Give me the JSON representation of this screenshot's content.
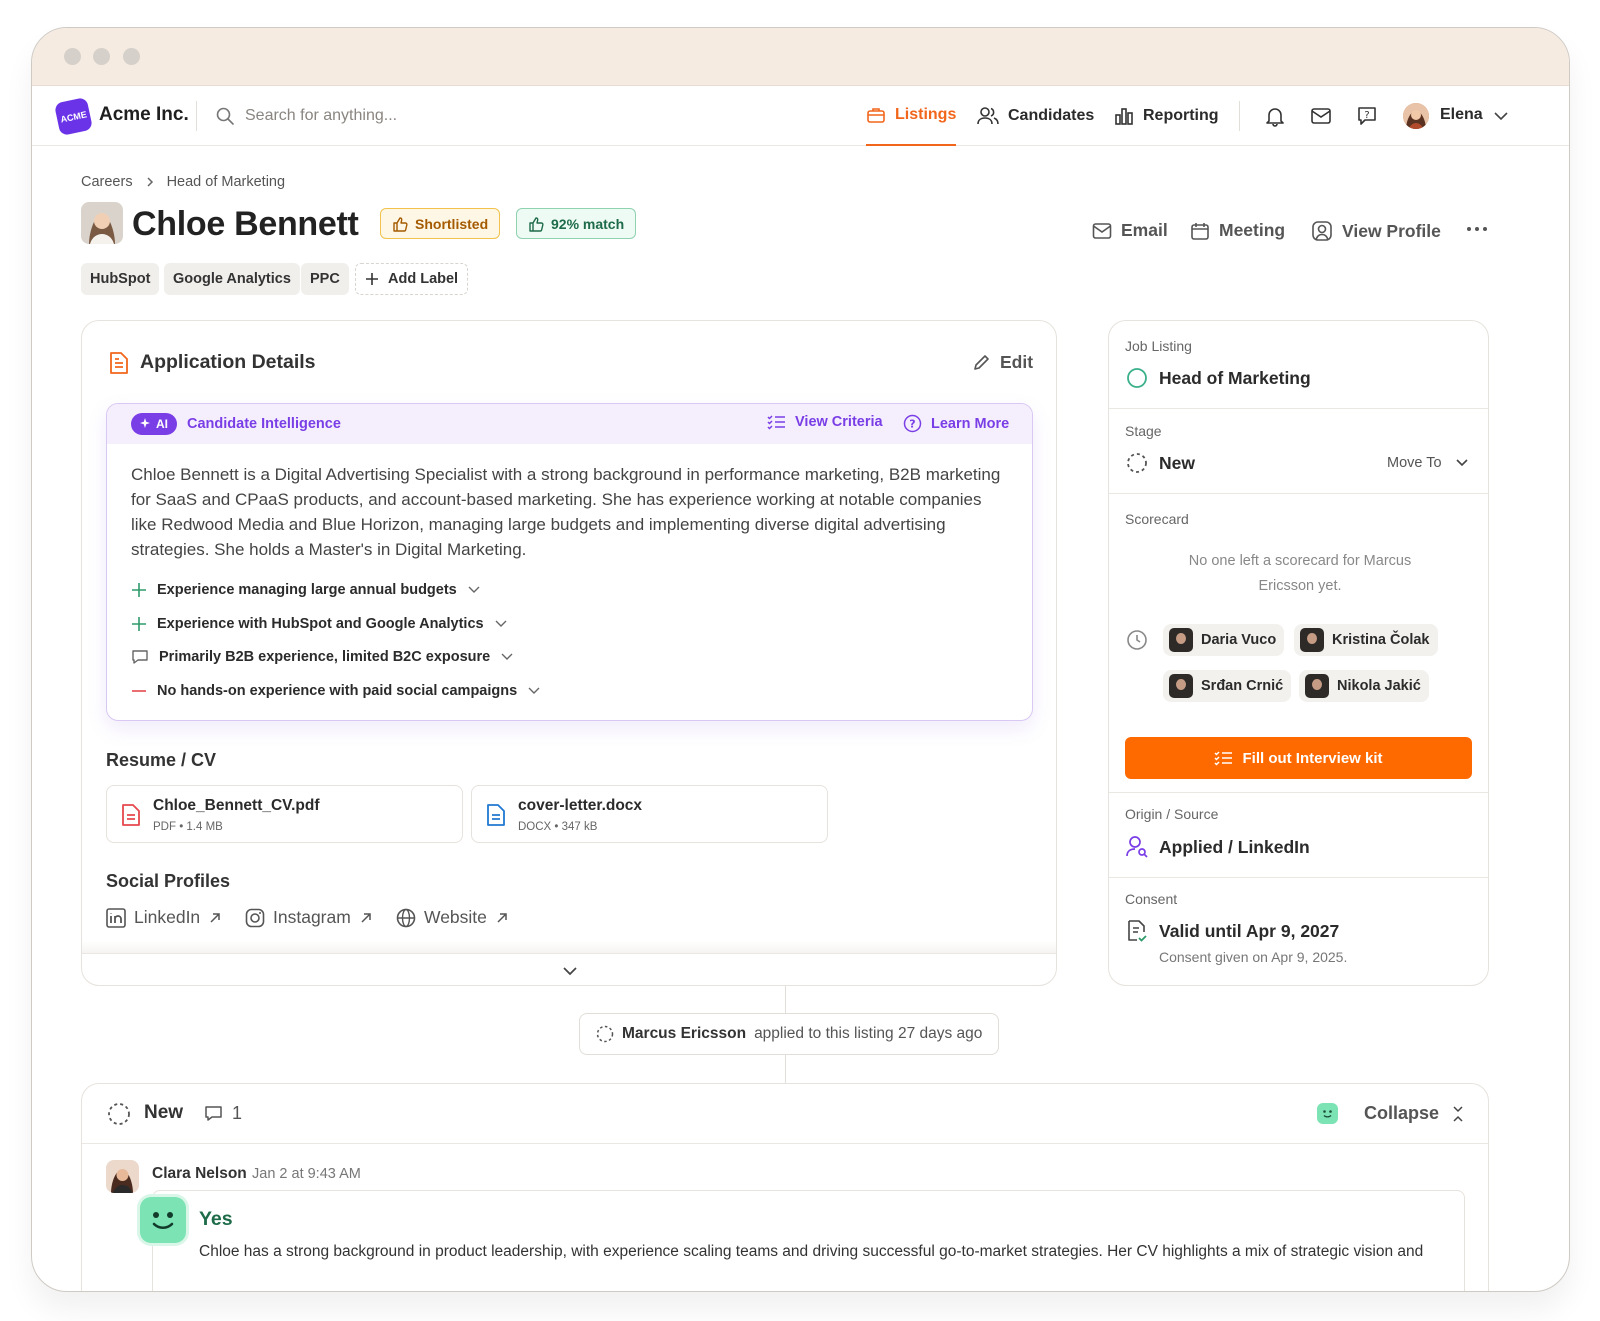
{
  "app": {
    "brand": "Acme Inc.",
    "logo_text": "ACME",
    "search_placeholder": "Search for anything...",
    "nav": [
      {
        "label": "Listings",
        "active": true
      },
      {
        "label": "Candidates",
        "active": false
      },
      {
        "label": "Reporting",
        "active": false
      }
    ],
    "user": "Elena",
    "accent": "#f2661c"
  },
  "breadcrumb": [
    "Careers",
    "Head of Marketing"
  ],
  "candidate": {
    "name": "Chloe Bennett",
    "status_badge": "Shortlisted",
    "match_badge": "92% match",
    "labels": [
      "HubSpot",
      "Google Analytics",
      "PPC"
    ],
    "add_label": "Add Label",
    "actions": [
      "Email",
      "Meeting",
      "View Profile"
    ]
  },
  "application": {
    "title": "Application Details",
    "edit": "Edit",
    "ai": {
      "badge": "AI",
      "title": "Candidate Intelligence",
      "view_criteria": "View Criteria",
      "learn_more": "Learn More",
      "summary": "Chloe Bennett is a Digital Advertising Specialist with a strong background in performance marketing, B2B marketing for SaaS and CPaaS products, and account-based marketing. She has experience working at notable companies like Redwood Media and Blue Horizon, managing large budgets and implementing diverse digital advertising strategies. She holds a Master's in Digital Marketing.",
      "findings": [
        {
          "type": "positive",
          "icon": "plus-icon",
          "text": "Experience managing large annual budgets"
        },
        {
          "type": "positive",
          "icon": "plus-icon",
          "text": "Experience with HubSpot and Google Analytics"
        },
        {
          "type": "neutral",
          "icon": "comment-icon",
          "text": "Primarily B2B experience, limited B2C exposure"
        },
        {
          "type": "negative",
          "icon": "minus-icon",
          "text": "No hands-on experience with paid social campaigns"
        }
      ]
    },
    "resume_title": "Resume / CV",
    "files": [
      {
        "name": "Chloe_Bennett_CV.pdf",
        "meta": "PDF • 1.4 MB",
        "icon": "pdf-icon"
      },
      {
        "name": "cover-letter.docx",
        "meta": "DOCX • 347 kB",
        "icon": "doc-icon"
      }
    ],
    "social_title": "Social Profiles",
    "socials": [
      "LinkedIn",
      "Instagram",
      "Website"
    ]
  },
  "sidebar": {
    "job_label": "Job Listing",
    "job_value": "Head of Marketing",
    "stage_label": "Stage",
    "stage_value": "New",
    "move_to": "Move To",
    "scorecard_label": "Scorecard",
    "scorecard_empty": "No one left a scorecard for Marcus Ericsson yet.",
    "interviewers": [
      "Daria Vuco",
      "Kristina Čolak",
      "Srđan Crnić",
      "Nikola Jakić"
    ],
    "cta": "Fill out Interview kit",
    "origin_label": "Origin / Source",
    "origin_value": "Applied / LinkedIn",
    "consent_label": "Consent",
    "consent_value": "Valid until Apr 9, 2027",
    "consent_note": "Consent given on Apr 9, 2025."
  },
  "activity": {
    "actor": "Marcus Ericsson",
    "text": "applied to this listing 27 days ago"
  },
  "stage_panel": {
    "stage": "New",
    "comment_count": "1",
    "collapse": "Collapse",
    "comment": {
      "author": "Clara Nelson",
      "time": "Jan 2 at 9:43 AM",
      "verdict": "Yes",
      "body": "Chloe has a strong background in product leadership, with experience scaling teams and driving successful go-to-market strategies. Her CV highlights a mix of strategic vision and"
    }
  }
}
